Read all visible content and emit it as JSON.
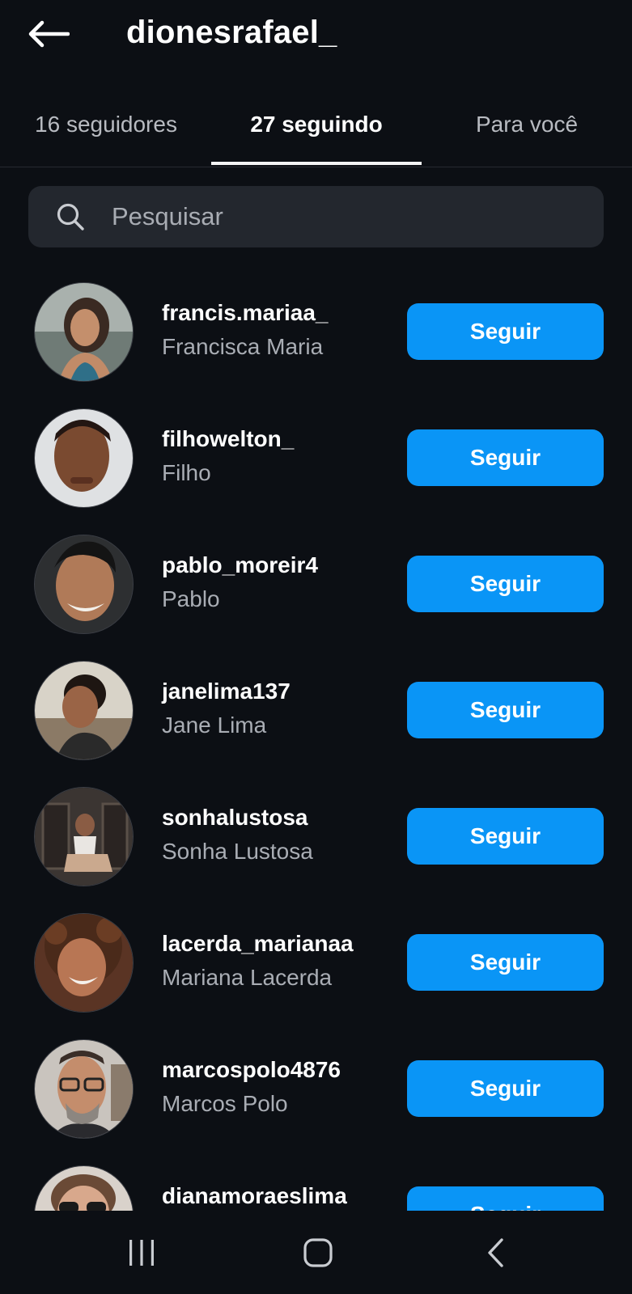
{
  "header": {
    "title": "dionesrafael_",
    "back_icon": "arrow-left-icon"
  },
  "tabs": [
    {
      "label": "16 seguidores",
      "active": false
    },
    {
      "label": "27 seguindo",
      "active": true
    },
    {
      "label": "Para você",
      "active": false
    }
  ],
  "search": {
    "placeholder": "Pesquisar",
    "icon": "search-icon"
  },
  "following": [
    {
      "username": "francis.mariaa_",
      "name": "Francisca Maria",
      "button": "Seguir"
    },
    {
      "username": "filhowelton_",
      "name": "Filho",
      "button": "Seguir"
    },
    {
      "username": "pablo_moreir4",
      "name": "Pablo",
      "button": "Seguir"
    },
    {
      "username": "janelima137",
      "name": "Jane Lima",
      "button": "Seguir"
    },
    {
      "username": "sonhalustosa",
      "name": "Sonha Lustosa",
      "button": "Seguir"
    },
    {
      "username": "lacerda_marianaa",
      "name": "Mariana Lacerda",
      "button": "Seguir"
    },
    {
      "username": "marcospolo4876",
      "name": "Marcos Polo",
      "button": "Seguir"
    },
    {
      "username": "dianamoraeslima",
      "name": "",
      "button": "Seguir"
    }
  ],
  "system_nav": {
    "recents_icon": "recent-apps-icon",
    "home_icon": "home-icon",
    "back_icon": "system-back-icon"
  },
  "colors": {
    "background": "#0c0f14",
    "follow_button": "#0a95f6",
    "search_bg": "#23272e",
    "secondary_text": "#a9adb4"
  }
}
